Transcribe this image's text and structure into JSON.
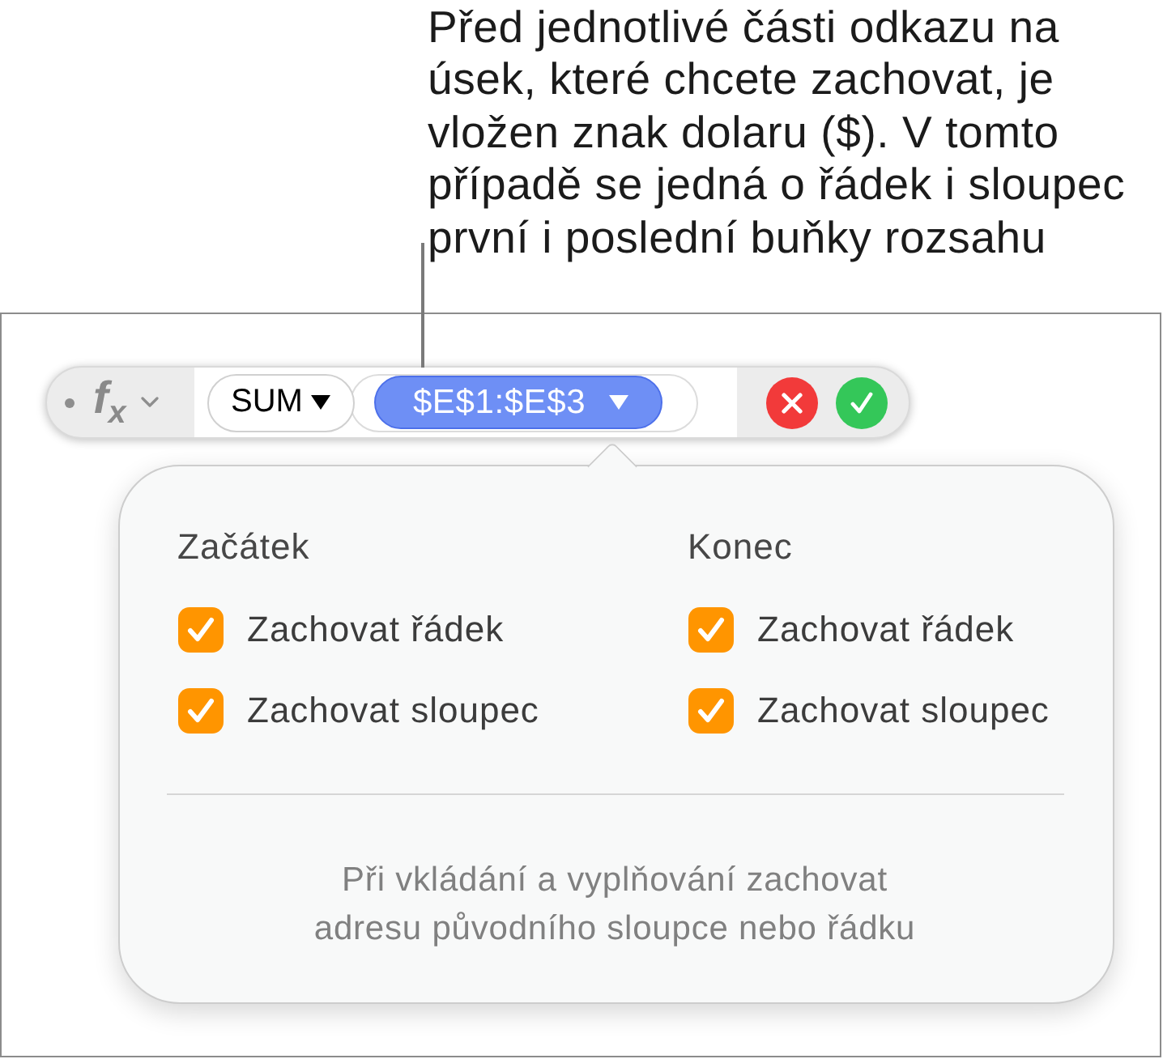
{
  "callout": {
    "text": "Před jednotlivé části odkazu na\núsek, které chcete zachovat, je\nvložen znak dolaru ($). V tomto\npřípadě se jedná o řádek i sloupec\nprvní i poslední buňky rozsahu"
  },
  "formula_bar": {
    "function_label": "f$_{x}$",
    "tokens": [
      {
        "kind": "function",
        "text": "SUM",
        "selected": false
      },
      {
        "kind": "argument",
        "text": "$E$1:$E$3",
        "selected": true
      }
    ]
  },
  "popover": {
    "columns": [
      {
        "heading": "Začátek",
        "options": [
          {
            "label": "Zachovat řádek",
            "checked": true
          },
          {
            "label": "Zachovat sloupec",
            "checked": true
          }
        ]
      },
      {
        "heading": "Konec",
        "options": [
          {
            "label": "Zachovat řádek",
            "checked": true
          },
          {
            "label": "Zachovat sloupec",
            "checked": true
          }
        ]
      }
    ],
    "note": "Při vkládání a vyplňování zachovat\nadresu původního sloupce nebo řádku"
  }
}
